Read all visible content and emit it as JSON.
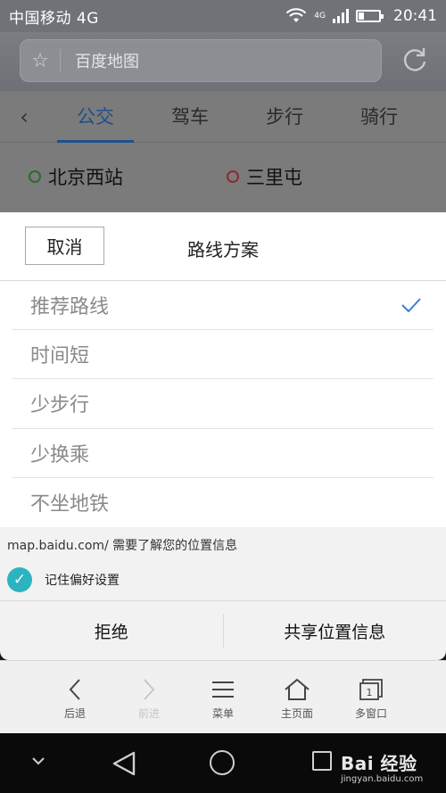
{
  "status_bar": {
    "carrier": "中国移动 4G",
    "network_badge": "4G",
    "time": "20:41",
    "battery_level": 0.25
  },
  "url_bar": {
    "text": "百度地图",
    "bookmark_icon": "star-icon",
    "refresh_icon": "refresh-icon"
  },
  "web_page": {
    "back_icon": "chevron-left-icon",
    "tabs": [
      {
        "label": "公交",
        "active": true
      },
      {
        "label": "驾车",
        "active": false
      },
      {
        "label": "步行",
        "active": false
      },
      {
        "label": "骑行",
        "active": false
      }
    ],
    "start": "北京西站",
    "end": "三里屯"
  },
  "route_sheet": {
    "cancel_label": "取消",
    "title": "路线方案",
    "options": [
      {
        "label": "推荐路线",
        "selected": true
      },
      {
        "label": "时间短",
        "selected": false
      },
      {
        "label": "少步行",
        "selected": false
      },
      {
        "label": "少换乘",
        "selected": false
      },
      {
        "label": "不坐地铁",
        "selected": false
      }
    ],
    "check_color": "#3b7fd1"
  },
  "permission": {
    "message": "map.baidu.com/ 需要了解您的位置信息",
    "remember_label": "记住偏好设置",
    "remember_checked": true,
    "deny_label": "拒绝",
    "share_label": "共享位置信息",
    "accent": "#2bb3c0"
  },
  "toolbar": {
    "back_label": "后退",
    "forward_label": "前进",
    "menu_label": "菜单",
    "home_label": "主页面",
    "windows_label": "多窗口",
    "window_count": "1"
  },
  "watermark": {
    "brand": "Bai 经验",
    "url": "jingyan.baidu.com"
  }
}
